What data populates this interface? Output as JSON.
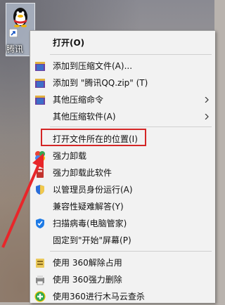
{
  "desktop": {
    "icon_label": "腾讯"
  },
  "menu": {
    "items": [
      {
        "label": "打开(O)"
      },
      {
        "label": "添加到压缩文件(A)..."
      },
      {
        "label": "添加到 \"腾讯QQ.zip\" (T)"
      },
      {
        "label": "其他压缩命令"
      },
      {
        "label": "其他压缩软件(A)"
      },
      {
        "label": "打开文件所在的位置(I)"
      },
      {
        "label": "强力卸载"
      },
      {
        "label": "强力卸载此软件"
      },
      {
        "label": "以管理员身份运行(A)"
      },
      {
        "label": "兼容性疑难解答(Y)"
      },
      {
        "label": "扫描病毒(电脑管家)"
      },
      {
        "label": "固定到\"开始\"屏幕(P)"
      },
      {
        "label": "使用 360解除占用"
      },
      {
        "label": "使用 360强力删除"
      },
      {
        "label": "使用360进行木马云查杀"
      }
    ]
  },
  "colors": {
    "highlight_border": "#d42626",
    "arrow": "#e8262a",
    "menu_bg": "#f2f2f2"
  },
  "icons": [
    "qq-penguin-icon",
    "archive-icon",
    "submenu-arrow-icon",
    "pinwheel-icon",
    "uninstall-icon",
    "shield-icon",
    "tencent-guard-icon",
    "360-unlock-icon",
    "360-delete-icon",
    "360-trojan-icon"
  ]
}
